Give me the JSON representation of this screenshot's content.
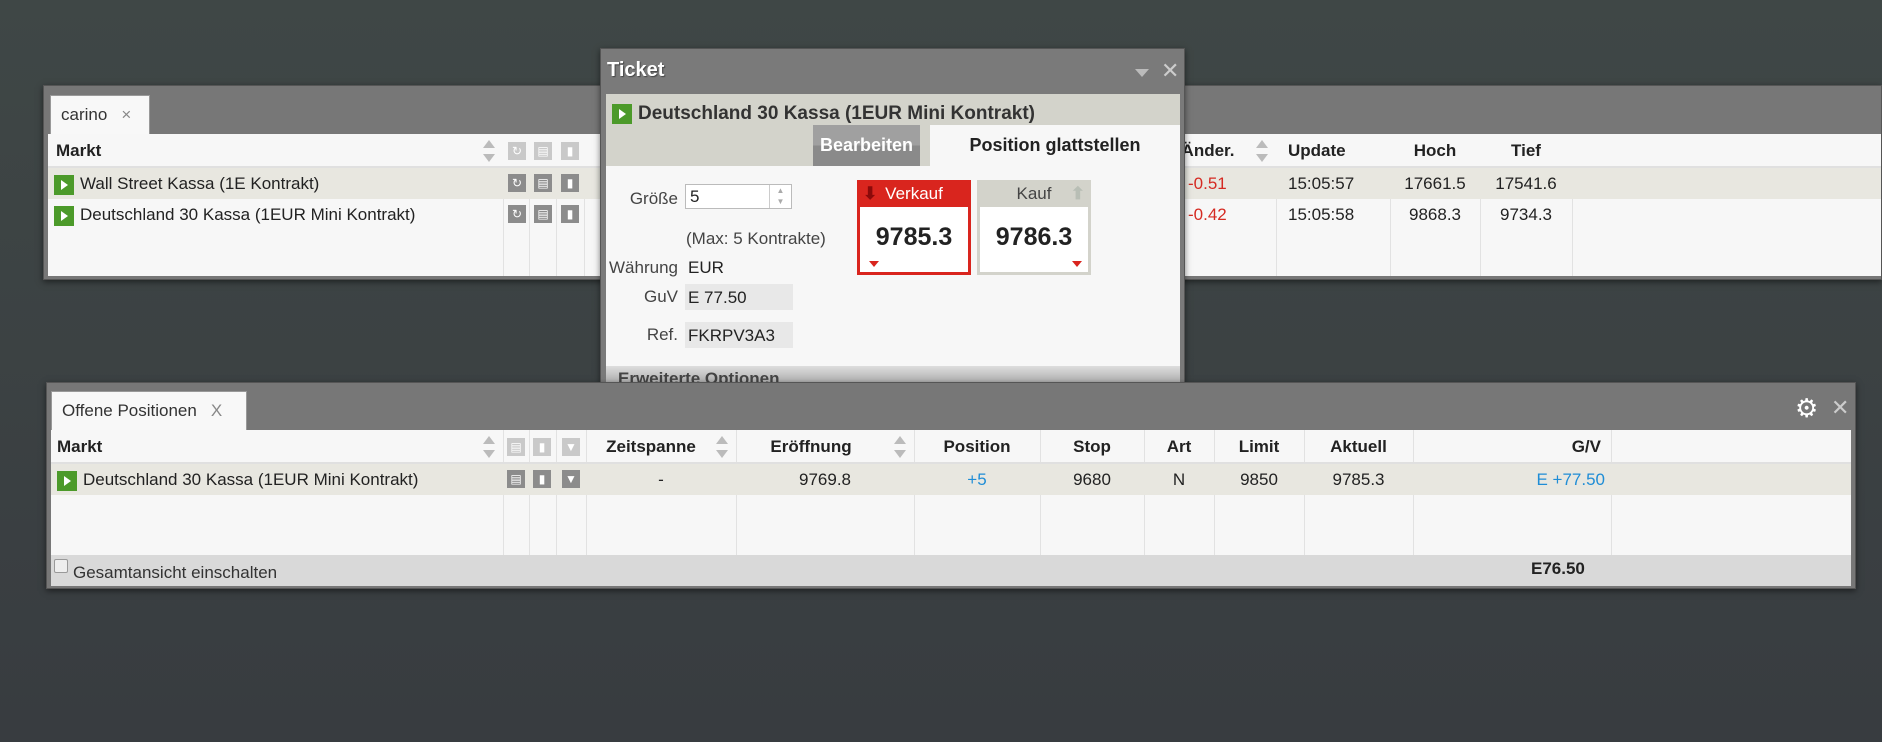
{
  "watchlist": {
    "tab": "carino",
    "close": "×",
    "headers": {
      "markt": "Markt",
      "aender": "Änder.",
      "update": "Update",
      "hoch": "Hoch",
      "tief": "Tief"
    },
    "rows": [
      {
        "markt": "Wall Street Kassa (1E Kontrakt)",
        "aender": "-0.51",
        "update": "15:05:57",
        "hoch": "17661.5",
        "tief": "17541.6"
      },
      {
        "markt": "Deutschland 30 Kassa (1EUR Mini Kontrakt)",
        "aender": "-0.42",
        "update": "15:05:58",
        "hoch": "9868.3",
        "tief": "9734.3"
      }
    ]
  },
  "ticket": {
    "title": "Ticket",
    "close": "✕",
    "product": "Deutschland 30 Kassa (1EUR Mini Kontrakt)",
    "tabs": [
      "Bearbeiten",
      "Position glattstellen"
    ],
    "size_label": "Größe",
    "size_value": "5",
    "max": "(Max: 5 Kontrakte)",
    "currency_label": "Währung",
    "currency": "EUR",
    "guv_label": "GuV",
    "guv": "E 77.50",
    "ref_label": "Ref.",
    "ref": "FKRPV3A3",
    "sell_label": "Verkauf",
    "sell_price": "9785.3",
    "buy_label": "Kauf",
    "buy_price": "9786.3",
    "advanced": "Erweiterte Optionen"
  },
  "positions": {
    "tab": "Offene Positionen",
    "close": "X",
    "headers": {
      "markt": "Markt",
      "zeitspanne": "Zeitspanne",
      "eroeffnung": "Eröffnung",
      "position": "Position",
      "stop": "Stop",
      "art": "Art",
      "limit": "Limit",
      "aktuell": "Aktuell",
      "gv": "G/V"
    },
    "rows": [
      {
        "markt": "Deutschland 30 Kassa (1EUR Mini Kontrakt)",
        "zeitspanne": "-",
        "eroeffnung": "9769.8",
        "position": "+5",
        "stop": "9680",
        "art": "N",
        "limit": "9850",
        "aktuell": "9785.3",
        "gv": "E +77.50"
      }
    ],
    "toggle_label": "Gesamtansicht einschalten",
    "total": "E76.50"
  },
  "colors": {
    "sell": "#d9251e",
    "positive": "#1f8dd6",
    "negative": "#d52a22",
    "accent": "#4c9a2a"
  }
}
